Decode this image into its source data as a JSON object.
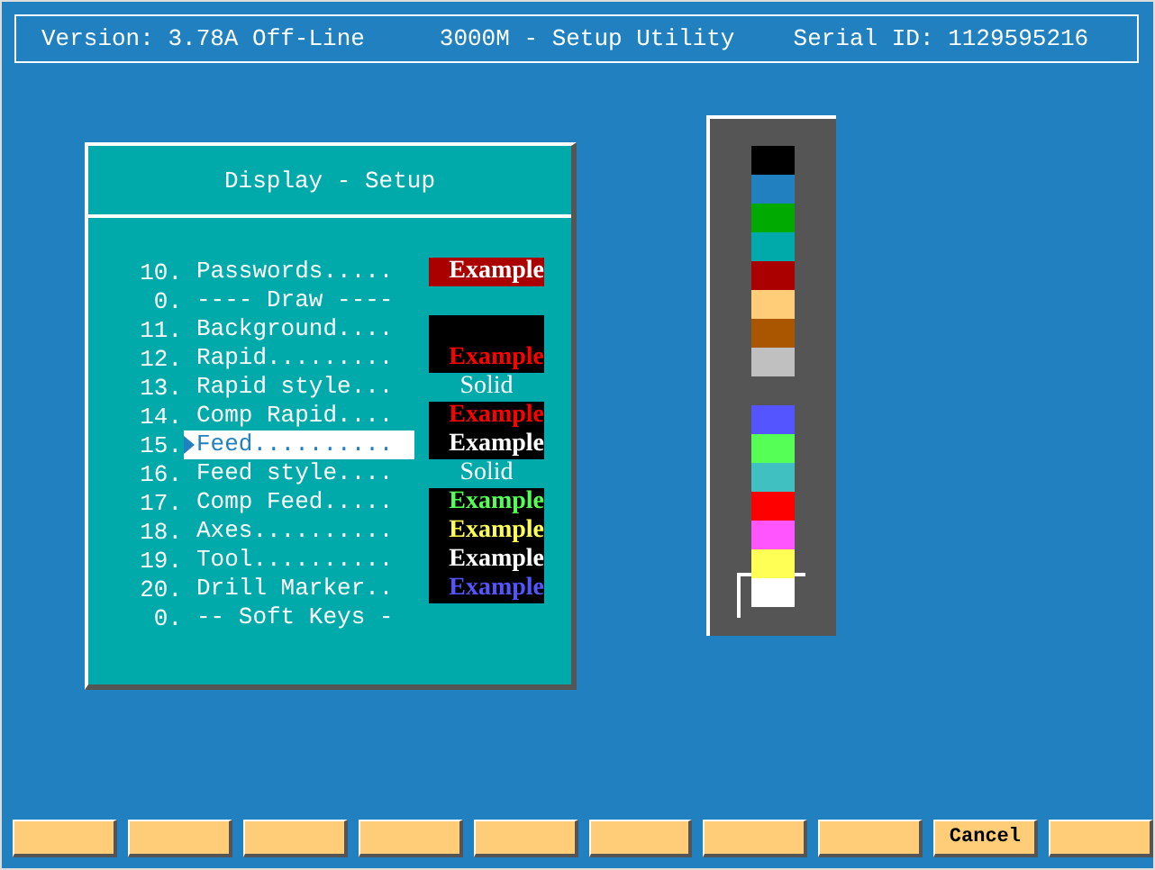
{
  "header": {
    "version": "Version: 3.78A Off-Line",
    "title": "3000M - Setup Utility",
    "serial": "Serial ID: 1129595216"
  },
  "dialog": {
    "title": "Display - Setup",
    "rows": [
      {
        "number": "10.",
        "label": "Passwords.....",
        "selected": false,
        "kind": "color",
        "sample": "Example",
        "color": "#ffffff",
        "swatch": {
          "color": "#aa0000"
        }
      },
      {
        "number": "0.",
        "label": "---- Draw ----",
        "selected": false,
        "kind": "none"
      },
      {
        "number": "11.",
        "label": "Background....",
        "selected": false,
        "kind": "color",
        "swatch": {
          "color": "#000000"
        }
      },
      {
        "number": "12.",
        "label": "Rapid.........",
        "selected": false,
        "kind": "color",
        "sample": "Example",
        "color": "#ff0000",
        "swatch": {
          "color": "#000000"
        }
      },
      {
        "number": "13.",
        "label": "Rapid style...",
        "selected": false,
        "kind": "style",
        "sample": "Solid"
      },
      {
        "number": "14.",
        "label": "Comp Rapid....",
        "selected": false,
        "kind": "color",
        "sample": "Example",
        "color": "#ff0000",
        "swatch": {
          "color": "#000000"
        }
      },
      {
        "number": "15.",
        "label": "Feed..........",
        "selected": true,
        "kind": "color",
        "sample": "Example",
        "color": "#ffffff",
        "swatch": {
          "color": "#000000"
        }
      },
      {
        "number": "16.",
        "label": "Feed style....",
        "selected": false,
        "kind": "style",
        "sample": "Solid"
      },
      {
        "number": "17.",
        "label": "Comp Feed.....",
        "selected": false,
        "kind": "color",
        "sample": "Example",
        "color": "#55ff55",
        "swatch": {
          "color": "#000000"
        }
      },
      {
        "number": "18.",
        "label": "Axes..........",
        "selected": false,
        "kind": "color",
        "sample": "Example",
        "color": "#ffff55",
        "swatch": {
          "color": "#000000"
        }
      },
      {
        "number": "19.",
        "label": "Tool..........",
        "selected": false,
        "kind": "color",
        "sample": "Example",
        "color": "#ffffff",
        "swatch": {
          "color": "#000000"
        }
      },
      {
        "number": "20.",
        "label": "Drill Marker..",
        "selected": false,
        "kind": "color",
        "sample": "Example",
        "color": "#5555ff",
        "swatch": {
          "color": "#000000"
        }
      },
      {
        "number": "0.",
        "label": "-- Soft Keys -",
        "selected": false,
        "kind": "none"
      }
    ]
  },
  "palette": {
    "groups": [
      [
        {
          "color": "#000000",
          "selected": false
        },
        {
          "color": "#2080c0",
          "selected": false
        },
        {
          "color": "#00aa00",
          "selected": false
        },
        {
          "color": "#00aaaa",
          "selected": false
        },
        {
          "color": "#aa0000",
          "selected": false
        },
        {
          "color": "#ffcc77",
          "selected": false
        },
        {
          "color": "#aa5500",
          "selected": false
        },
        {
          "color": "#c0c0c0",
          "selected": false
        }
      ],
      [
        {
          "color": "#5555ff",
          "selected": false
        },
        {
          "color": "#55ff55",
          "selected": false
        },
        {
          "color": "#40c0c0",
          "selected": false
        },
        {
          "color": "#ff0000",
          "selected": false
        },
        {
          "color": "#ff55ff",
          "selected": false
        },
        {
          "color": "#ffff55",
          "selected": false
        },
        {
          "color": "#ffffff",
          "selected": true
        }
      ]
    ]
  },
  "soft_keys": [
    {
      "kind": "blank"
    },
    {
      "kind": "blank"
    },
    {
      "kind": "blank"
    },
    {
      "kind": "blank"
    },
    {
      "kind": "blank"
    },
    {
      "kind": "blank"
    },
    {
      "kind": "blank"
    },
    {
      "kind": "blank"
    },
    {
      "kind": "labeled",
      "label": "Cancel"
    },
    {
      "kind": "blank"
    }
  ]
}
